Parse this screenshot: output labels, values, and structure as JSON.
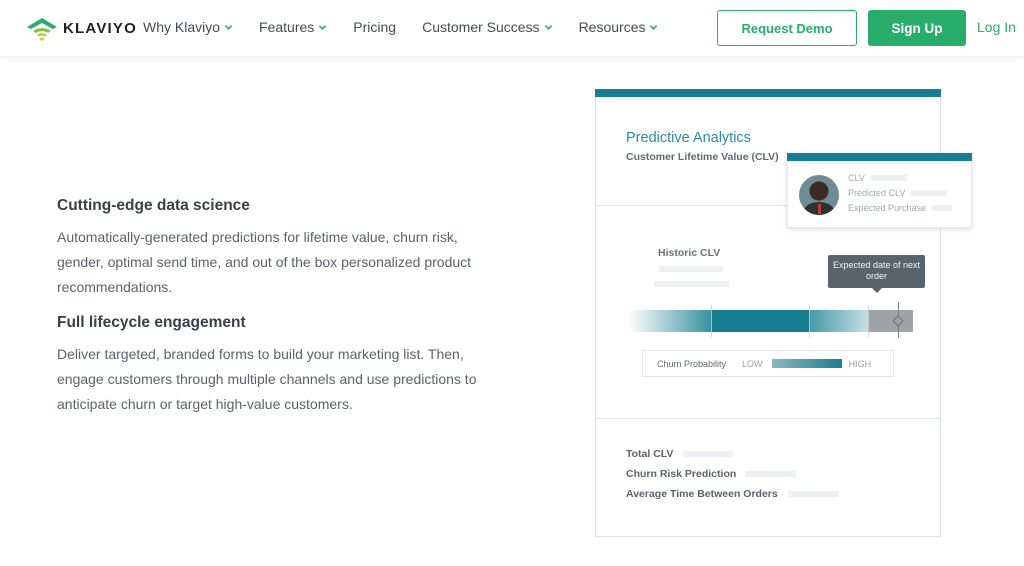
{
  "brand": {
    "name": "KLAVIYO",
    "accent": "#28ad6a",
    "teal": "#177f91"
  },
  "nav": {
    "items": [
      {
        "label": "Why Klaviyo",
        "has_dropdown": true
      },
      {
        "label": "Features",
        "has_dropdown": true
      },
      {
        "label": "Pricing",
        "has_dropdown": false
      },
      {
        "label": "Customer Success",
        "has_dropdown": true
      },
      {
        "label": "Resources",
        "has_dropdown": true
      }
    ],
    "request_demo": "Request Demo",
    "sign_up": "Sign Up",
    "log_in": "Log In"
  },
  "features": [
    {
      "title": "Cutting-edge data science",
      "body": "Automatically-generated predictions for lifetime value, churn risk, gender, optimal send time, and out of the box personalized product recommendations."
    },
    {
      "title": "Full lifecycle engagement",
      "body": "Deliver targeted, branded forms to build your marketing list. Then, engage customers through multiple channels and use predictions to anticipate churn or target high-value customers."
    }
  ],
  "illustration": {
    "title": "Predictive Analytics",
    "subtitle": "Customer Lifetime Value (CLV)",
    "popup": {
      "rows": [
        "CLV",
        "Predicted CLV",
        "Expected Purchase"
      ]
    },
    "historic_label": "Historic CLV",
    "tooltip": "Expected date of next order",
    "churn": {
      "label": "Churn Probability",
      "low": "LOW",
      "high": "HIGH"
    },
    "stats": [
      "Total CLV",
      "Churn Risk Prediction",
      "Average Time Between Orders"
    ]
  }
}
